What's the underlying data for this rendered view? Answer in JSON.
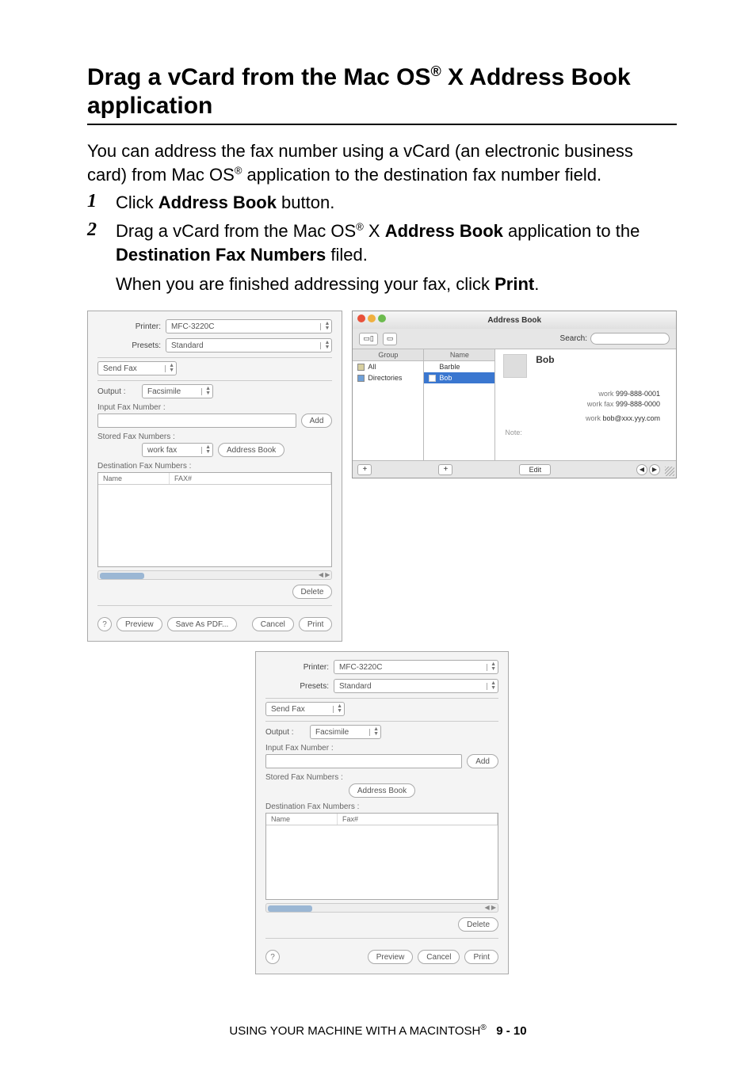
{
  "heading_pre": "Drag a vCard from the Mac OS",
  "heading_reg": "®",
  "heading_post": " X Address Book application",
  "intro_1": "You can address the fax number using a vCard (an electronic business card) from Mac OS",
  "intro_reg": "®",
  "intro_2": " application to the destination fax number field.",
  "step1_pre": "Click ",
  "step1_bold": "Address Book",
  "step1_post": " button.",
  "step2_pre": "Drag a vCard from the Mac OS",
  "step2_reg": "®",
  "step2_mid": " X ",
  "step2_bold1": "Address Book",
  "step2_mid2": " application to the ",
  "step2_bold2": "Destination Fax Numbers",
  "step2_post": " filed.",
  "step2_line3_pre": "When you are finished addressing your fax, click ",
  "step2_line3_bold": "Print",
  "step2_line3_post": ".",
  "pd": {
    "printer_label": "Printer:",
    "printer_value": "MFC-3220C",
    "presets_label": "Presets:",
    "presets_value": "Standard",
    "panel": "Send Fax",
    "output_label": "Output :",
    "output_value": "Facsimile",
    "input_fax_label": "Input Fax Number :",
    "add_btn": "Add",
    "stored_label": "Stored Fax Numbers :",
    "stored_value": "work fax",
    "addrbook_btn": "Address Book",
    "dest_label": "Destination Fax Numbers :",
    "col_name": "Name",
    "col_fax": "FAX#",
    "col_fax2": "Fax#",
    "delete_btn": "Delete",
    "help": "?",
    "preview_btn": "Preview",
    "save_pdf_btn": "Save As PDF...",
    "cancel_btn": "Cancel",
    "print_btn": "Print"
  },
  "ab": {
    "title": "Address Book",
    "search_label": "Search:",
    "group_hdr": "Group",
    "name_hdr": "Name",
    "group_all": "All",
    "group_dirs": "Directories",
    "name_barble": "Barble",
    "name_bob": "Bob",
    "card_name": "Bob",
    "work_lbl": "work",
    "work_fax_lbl": "work fax",
    "work_num": "999-888-0001",
    "work_fax_num": "999-888-0000",
    "work_email": "bob@xxx.yyy.com",
    "note_lbl": "Note:",
    "edit_btn": "Edit",
    "plus": "+"
  },
  "footer_pre": "USING YOUR MACHINE WITH A MACINTOSH",
  "footer_reg": "®",
  "footer_page": "9 - 10"
}
